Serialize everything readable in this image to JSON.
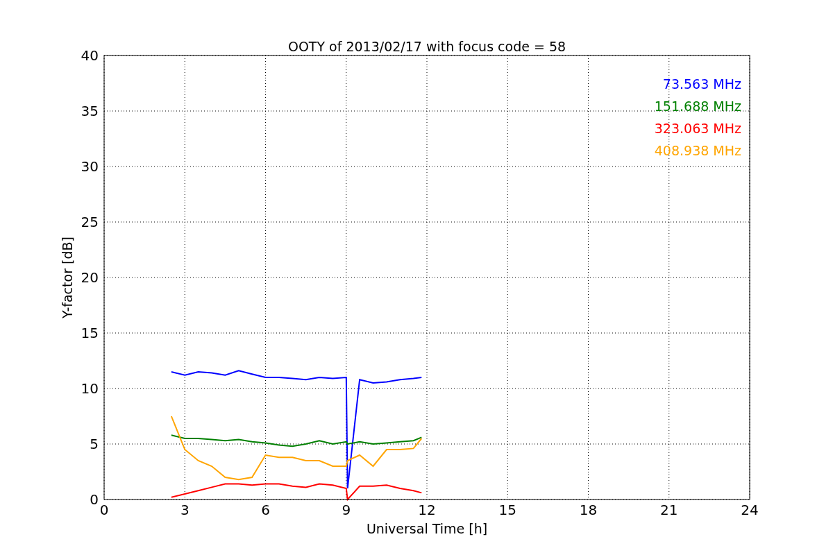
{
  "figure": {
    "chart_data": {
      "type": "line",
      "title": "OOTY of 2013/02/17 with focus code = 58",
      "xlabel": "Universal Time [h]",
      "ylabel": "Y-factor [dB]",
      "x": [
        2.5,
        3,
        3.5,
        4,
        4.5,
        5,
        5.5,
        6,
        6.5,
        7,
        7.5,
        8,
        8.5,
        9,
        9.05,
        9.5,
        10,
        10.5,
        11,
        11.5,
        11.8
      ],
      "series": [
        {
          "name": "73.563 MHz",
          "color": "#0000ff",
          "values": [
            11.5,
            11.2,
            11.5,
            11.4,
            11.2,
            11.6,
            11.3,
            11.0,
            11.0,
            10.9,
            10.8,
            11.0,
            10.9,
            11.0,
            1.0,
            10.8,
            10.5,
            10.6,
            10.8,
            10.9,
            11.0
          ]
        },
        {
          "name": "151.688 MHz",
          "color": "#008000",
          "values": [
            5.8,
            5.5,
            5.5,
            5.4,
            5.3,
            5.4,
            5.2,
            5.1,
            4.9,
            4.8,
            5.0,
            5.3,
            5.0,
            5.2,
            5.0,
            5.2,
            5.0,
            5.1,
            5.2,
            5.3,
            5.6
          ]
        },
        {
          "name": "323.063 MHz",
          "color": "#ff0000",
          "values": [
            0.2,
            0.5,
            0.8,
            1.1,
            1.4,
            1.4,
            1.3,
            1.4,
            1.4,
            1.2,
            1.1,
            1.4,
            1.3,
            1.0,
            0.0,
            1.2,
            1.2,
            1.3,
            1.0,
            0.8,
            0.6
          ]
        },
        {
          "name": "408.938 MHz",
          "color": "#ffa500",
          "values": [
            7.5,
            4.5,
            3.5,
            3.0,
            2.0,
            1.8,
            2.0,
            4.0,
            3.8,
            3.8,
            3.5,
            3.5,
            3.0,
            3.0,
            3.5,
            4.0,
            3.0,
            4.5,
            4.5,
            4.6,
            5.5
          ]
        }
      ],
      "xlim": [
        0,
        24
      ],
      "ylim": [
        0,
        40
      ],
      "xticks": [
        0,
        3,
        6,
        9,
        12,
        15,
        18,
        21,
        24
      ],
      "yticks": [
        0,
        5,
        10,
        15,
        20,
        25,
        30,
        35,
        40
      ],
      "grid": true
    }
  }
}
